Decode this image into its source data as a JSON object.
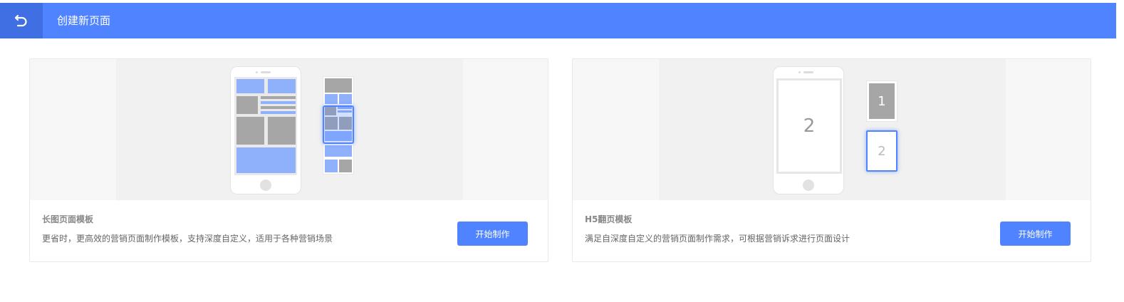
{
  "header": {
    "title": "创建新页面",
    "back_icon": "undo-arrow-icon",
    "color": "#5083ff"
  },
  "cards": [
    {
      "title": "长图页面模板",
      "description": "更省时，更高效的营销页面制作模板，支持深度自定义，适用于各种营销场景",
      "button_label": "开始制作"
    },
    {
      "title": "H5翻页模板",
      "description": "满足自深度自定义的营销页面制作需求，可根据营销诉求进行页面设计",
      "button_label": "开始制作",
      "preview": {
        "main_page": "2",
        "thumb_1": "1",
        "thumb_2": "2"
      }
    }
  ]
}
